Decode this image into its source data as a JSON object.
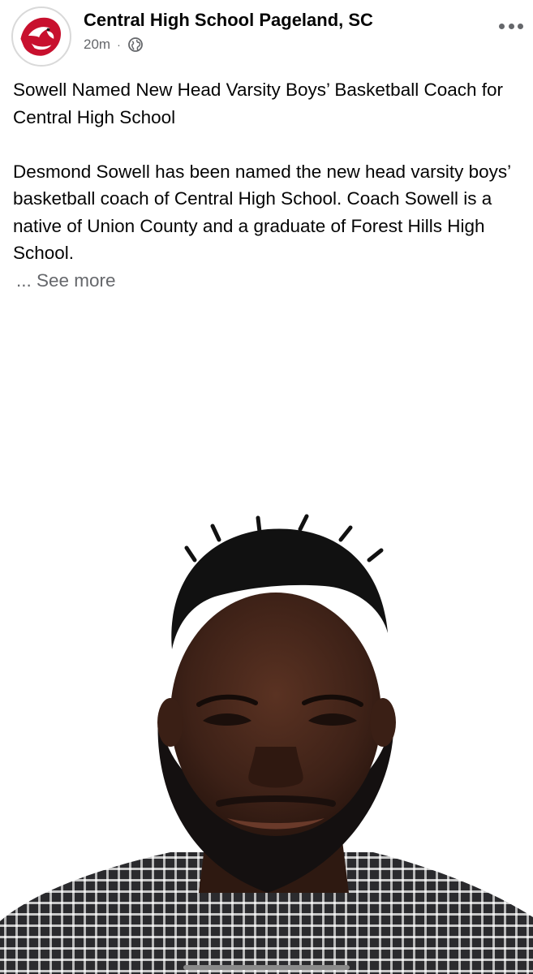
{
  "header": {
    "page_name": "Central High School Pageland, SC",
    "timestamp": "20m",
    "separator": "·",
    "audience_icon": "globe-icon",
    "more_icon": "more-options-icon",
    "avatar_icon": "eagle-logo-icon"
  },
  "post": {
    "title": "Sowell Named New Head Varsity Boys’ Basketball Coach for Central High School",
    "body": "Desmond Sowell has been named the new head varsity boys’ basketball coach of Central High School. Coach Sowell is a native of Union County and a graduate of Forest Hills High School.",
    "see_more": "... See more"
  },
  "photo": {
    "subject": "headshot-photo"
  },
  "colors": {
    "text_primary": "#050505",
    "text_secondary": "#65676b",
    "logo_red": "#c8102e"
  }
}
